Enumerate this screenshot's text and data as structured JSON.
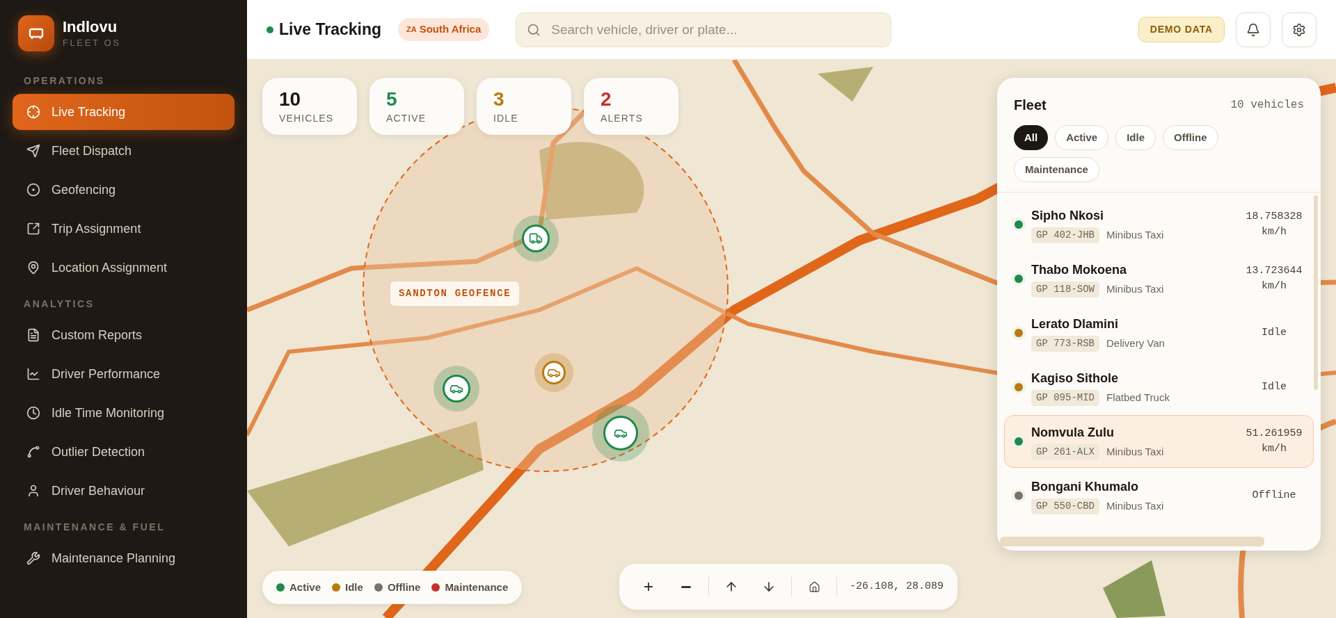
{
  "brand": {
    "name": "Indlovu",
    "subtitle": "FLEET OS"
  },
  "sidebar": {
    "sections": [
      {
        "title": "OPERATIONS",
        "items": [
          {
            "label": "Live Tracking",
            "selected": true
          },
          {
            "label": "Fleet Dispatch",
            "selected": false
          },
          {
            "label": "Geofencing",
            "selected": false
          },
          {
            "label": "Trip Assignment",
            "selected": false
          },
          {
            "label": "Location Assignment",
            "selected": false
          }
        ]
      },
      {
        "title": "ANALYTICS",
        "items": [
          {
            "label": "Custom Reports",
            "selected": false
          },
          {
            "label": "Driver Performance",
            "selected": false
          },
          {
            "label": "Idle Time Monitoring",
            "selected": false
          },
          {
            "label": "Outlier Detection",
            "selected": false
          },
          {
            "label": "Driver Behaviour",
            "selected": false
          }
        ]
      },
      {
        "title": "MAINTENANCE & FUEL",
        "items": [
          {
            "label": "Maintenance Planning",
            "selected": false
          }
        ]
      }
    ]
  },
  "header": {
    "title": "Live Tracking",
    "live": true,
    "region": {
      "code": "ZA",
      "label": "South Africa"
    },
    "search": {
      "placeholder": "Search vehicle, driver or plate..."
    },
    "badge": "DEMO DATA"
  },
  "stats": [
    {
      "value": "10",
      "label": "VEHICLES",
      "color": "#1c1713"
    },
    {
      "value": "5",
      "label": "ACTIVE",
      "color": "#1e8a4c"
    },
    {
      "value": "3",
      "label": "IDLE",
      "color": "#b97a0f"
    },
    {
      "value": "2",
      "label": "ALERTS",
      "color": "#c9302c"
    }
  ],
  "map": {
    "geofence_label": "SANDTON GEOFENCE",
    "markers": [
      {
        "kind": "truck",
        "color": "#1e8a4c"
      },
      {
        "kind": "car",
        "color": "#b97a0f"
      },
      {
        "kind": "car",
        "color": "#1e8a4c"
      },
      {
        "kind": "car",
        "color": "#1e8a4c"
      }
    ]
  },
  "fleet": {
    "title": "Fleet",
    "count": "10 vehicles",
    "filters": [
      {
        "label": "All",
        "selected": true
      },
      {
        "label": "Active",
        "selected": false
      },
      {
        "label": "Idle",
        "selected": false
      },
      {
        "label": "Offline",
        "selected": false
      },
      {
        "label": "Maintenance",
        "selected": false
      }
    ],
    "vehicles": [
      {
        "driver": "Sipho Nkosi",
        "plate": "GP 402-JHB",
        "type": "Minibus Taxi",
        "reading": "18.758328 km/h",
        "color": "#1e8a4c",
        "selected": false
      },
      {
        "driver": "Thabo Mokoena",
        "plate": "GP 118-SOW",
        "type": "Minibus Taxi",
        "reading": "13.723644 km/h",
        "color": "#1e8a4c",
        "selected": false
      },
      {
        "driver": "Lerato Dlamini",
        "plate": "GP 773-RSB",
        "type": "Delivery Van",
        "reading": "Idle",
        "color": "#b97a0f",
        "selected": false
      },
      {
        "driver": "Kagiso Sithole",
        "plate": "GP 095-MID",
        "type": "Flatbed Truck",
        "reading": "Idle",
        "color": "#b97a0f",
        "selected": false
      },
      {
        "driver": "Nomvula Zulu",
        "plate": "GP 261-ALX",
        "type": "Minibus Taxi",
        "reading": "51.261959 km/h",
        "color": "#1e8a4c",
        "selected": true
      },
      {
        "driver": "Bongani Khumalo",
        "plate": "GP 550-CBD",
        "type": "Minibus Taxi",
        "reading": "Offline",
        "color": "#7a7067",
        "selected": false
      }
    ]
  },
  "legend": [
    {
      "label": "Active",
      "color": "#1e8a4c"
    },
    {
      "label": "Idle",
      "color": "#b97a0f"
    },
    {
      "label": "Offline",
      "color": "#7a7067"
    },
    {
      "label": "Maintenance",
      "color": "#c9302c"
    }
  ],
  "coordinates": "-26.108, 28.089"
}
